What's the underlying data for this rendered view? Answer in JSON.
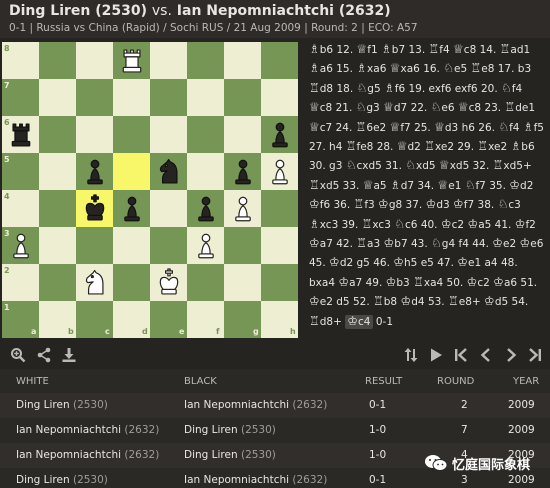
{
  "header": {
    "white_name": "Ding Liren (2530)",
    "vs": "vs.",
    "black_name": "Ian Nepomniachtchi (2632)",
    "subtitle": "0-1 | Russia vs China (Rapid) / Sochi RUS / 21 Aug 2009 | Round: 2 | ECO: A57"
  },
  "board": {
    "files": [
      "a",
      "b",
      "c",
      "d",
      "e",
      "f",
      "g",
      "h"
    ],
    "ranks": [
      "8",
      "7",
      "6",
      "5",
      "4",
      "3",
      "2",
      "1"
    ],
    "highlighted": [
      "d5",
      "c4"
    ],
    "pieces": [
      {
        "sq": "d8",
        "piece": "wR"
      },
      {
        "sq": "a6",
        "piece": "bR"
      },
      {
        "sq": "h6",
        "piece": "bP"
      },
      {
        "sq": "c5",
        "piece": "bP"
      },
      {
        "sq": "e5",
        "piece": "bN"
      },
      {
        "sq": "g5",
        "piece": "bP"
      },
      {
        "sq": "h5",
        "piece": "wP"
      },
      {
        "sq": "c4",
        "piece": "bK"
      },
      {
        "sq": "d4",
        "piece": "bP"
      },
      {
        "sq": "f4",
        "piece": "bP"
      },
      {
        "sq": "g4",
        "piece": "wP"
      },
      {
        "sq": "a3",
        "piece": "wP"
      },
      {
        "sq": "f3",
        "piece": "wP"
      },
      {
        "sq": "c2",
        "piece": "wN"
      },
      {
        "sq": "e2",
        "piece": "wK"
      }
    ],
    "light_color": "#eeeed2",
    "dark_color": "#769656",
    "highlight_color": "#f7f769"
  },
  "moves_text": [
    [
      "",
      "b6",
      "12.",
      "f1",
      "b7",
      "13.",
      "f4",
      "c8",
      "14.",
      "ad1"
    ],
    [
      "",
      "a6",
      "15.",
      "xa6",
      "xa6",
      "16.",
      "e5",
      "e8",
      "17.",
      "b3"
    ],
    [
      "",
      "d8",
      "18.",
      "g5",
      "f6",
      "19.",
      "exf6",
      "exf6",
      "20.",
      "f4",
      "c8"
    ],
    [
      "21.",
      "g3",
      "d7",
      "22.",
      "e6",
      "c8",
      "23.",
      "de1",
      "c7"
    ],
    [
      "24.",
      "6e2",
      "f7",
      "25.",
      "d3",
      "h6",
      "26.",
      "f4",
      "f5",
      "27."
    ],
    [
      "h4",
      "fe8",
      "28.",
      "d2",
      "xe2",
      "29.",
      "xe2",
      "b6",
      "30."
    ],
    [
      "g3",
      "cxd5",
      "31.",
      "xd5",
      "xd5",
      "32.",
      "xd5+"
    ],
    [
      "",
      "xd5",
      "33.",
      "a5",
      "d7",
      "34.",
      "e1",
      "f7",
      "35.",
      "d2"
    ],
    [
      "",
      "f6",
      "36.",
      "f3",
      "g8",
      "37.",
      "d3",
      "f7",
      "38.",
      "c3"
    ],
    [
      "",
      "xc3",
      "39.",
      "xc3",
      "c6",
      "40.",
      "c2",
      "a5",
      "41.",
      "f2"
    ],
    [
      "",
      "a7",
      "42.",
      "a3",
      "b7",
      "43.",
      "g4",
      "f4",
      "44.",
      "e2",
      "e6",
      "45."
    ],
    [
      "",
      "d2",
      "g5",
      "46.",
      "h5",
      "e5",
      "47.",
      "e1",
      "a4",
      "48.",
      "bxa4"
    ],
    [
      "",
      "a7",
      "49.",
      "b3",
      "xa4",
      "50.",
      "c2",
      "a6",
      "51.",
      "e2"
    ],
    [
      "d5",
      "52.",
      "b8",
      "d4",
      "53.",
      "e8+",
      "d5",
      "54.",
      "d8+"
    ],
    [
      "",
      "c4",
      "0-1"
    ]
  ],
  "toolbar": {
    "left_icons": [
      "search-plus-icon",
      "share-icon",
      "download-icon"
    ],
    "right_icons": [
      "flip-icon",
      "play-icon",
      "first-move-icon",
      "prev-move-icon",
      "next-move-icon",
      "last-move-icon"
    ]
  },
  "games": {
    "columns": [
      "WHITE",
      "BLACK",
      "RESULT",
      "ROUND",
      "YEAR"
    ],
    "rows": [
      {
        "white_name": "Ding Liren",
        "white_elo": "(2530)",
        "black_name": "Ian Nepomniachtchi",
        "black_elo": "(2632)",
        "result": "0-1",
        "round": "2",
        "year": "2009"
      },
      {
        "white_name": "Ian Nepomniachtchi",
        "white_elo": "(2632)",
        "black_name": "Ding Liren",
        "black_elo": "(2530)",
        "result": "1-0",
        "round": "7",
        "year": "2009"
      },
      {
        "white_name": "Ian Nepomniachtchi",
        "white_elo": "(2632)",
        "black_name": "Ding Liren",
        "black_elo": "(2530)",
        "result": "1-0",
        "round": "4",
        "year": "2009"
      },
      {
        "white_name": "Ding Liren",
        "white_elo": "(2530)",
        "black_name": "Ian Nepomniachtchi",
        "black_elo": "(2632)",
        "result": "0-1",
        "round": "3",
        "year": "2009"
      }
    ]
  },
  "watermark": {
    "text": "忆庭国际象棋"
  }
}
